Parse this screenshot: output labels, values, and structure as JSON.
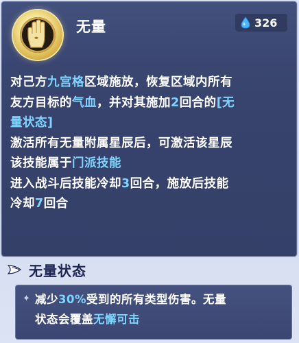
{
  "skill": {
    "name": "无量",
    "cost": "326",
    "icon": "palm-seal-icon"
  },
  "description": {
    "line1": [
      {
        "t": "对己方",
        "hl": false
      },
      {
        "t": "九宫格",
        "hl": true
      },
      {
        "t": "区域施放，恢复区域内所有",
        "hl": false
      }
    ],
    "line2": [
      {
        "t": "友方目标的",
        "hl": false
      },
      {
        "t": "气血",
        "hl": true
      },
      {
        "t": "，并对其施加",
        "hl": false
      },
      {
        "t": "2",
        "hl": true
      },
      {
        "t": "回合的",
        "hl": false
      },
      {
        "t": "[无",
        "hl": true
      }
    ],
    "line3": [
      {
        "t": "量状态]",
        "hl": true
      }
    ],
    "line4": [
      {
        "t": "激活所有无量附属星辰后，可激活该星辰",
        "hl": false
      }
    ],
    "line5": [
      {
        "t": "该技能属于",
        "hl": false
      },
      {
        "t": "门派技能",
        "hl": true
      }
    ],
    "line6": [
      {
        "t": "进入战斗后技能冷却",
        "hl": false
      },
      {
        "t": "3",
        "hl": true
      },
      {
        "t": "回合，施放后技能",
        "hl": false
      }
    ],
    "line7": [
      {
        "t": "冷却",
        "hl": false
      },
      {
        "t": "7",
        "hl": true
      },
      {
        "t": "回合",
        "hl": false
      }
    ]
  },
  "status": {
    "title": "无量状态",
    "line1": [
      {
        "t": "减少",
        "hl": false
      },
      {
        "t": "30%",
        "hl": true
      },
      {
        "t": "受到的所有类型伤害。无量",
        "hl": false
      }
    ],
    "line2": [
      {
        "t": "状态会覆盖",
        "hl": false
      },
      {
        "t": "无懈可击",
        "hl": true
      }
    ]
  },
  "colors": {
    "highlight": "#7fd4ff",
    "panel": "#37436c",
    "background": "#d3dcf0"
  }
}
